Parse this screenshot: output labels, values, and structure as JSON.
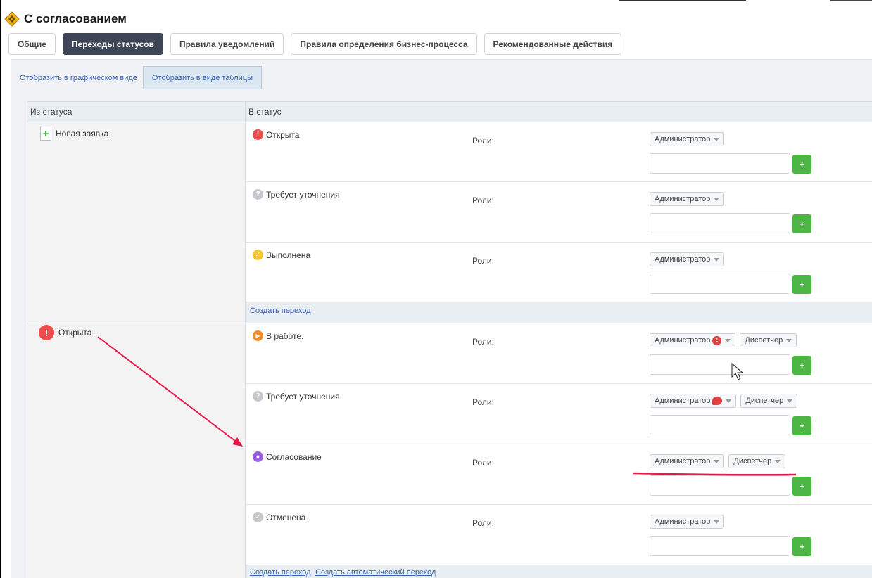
{
  "title": "С согласованием",
  "tabs": [
    {
      "label": "Общие",
      "active": false
    },
    {
      "label": "Переходы статусов",
      "active": true
    },
    {
      "label": "Правила уведомлений",
      "active": false
    },
    {
      "label": "Правила определения бизнес-процесса",
      "active": false
    },
    {
      "label": "Рекомендованные действия",
      "active": false
    }
  ],
  "view": {
    "graphic": "Отобразить в графическом виде",
    "table": "Отобразить в виде таблицы"
  },
  "table": {
    "col_from": "Из статуса",
    "col_to": "В статус",
    "roles_label": "Роли:",
    "add_symbol": "+"
  },
  "groups": [
    {
      "from": "Новая заявка",
      "from_icon": "plus-icon",
      "transitions": [
        {
          "status": "Открыта",
          "icon": "exclamation-icon",
          "roles": [
            "Администратор"
          ]
        },
        {
          "status": "Требует уточнения",
          "icon": "question-icon",
          "roles": [
            "Администратор"
          ]
        },
        {
          "status": "Выполнена",
          "icon": "check-icon",
          "roles": [
            "Администратор"
          ]
        }
      ],
      "links": [
        "Создать переход"
      ]
    },
    {
      "from": "Открыта",
      "from_icon": "exclamation-icon",
      "transitions": [
        {
          "status": "В работе.",
          "icon": "play-icon",
          "roles": [
            "Администратор",
            "Диспетчер"
          ]
        },
        {
          "status": "Требует уточнения",
          "icon": "question-icon",
          "roles": [
            "Администратор",
            "Диспетчер"
          ]
        },
        {
          "status": "Согласование",
          "icon": "drop-icon",
          "roles": [
            "Администратор",
            "Диспетчер"
          ]
        },
        {
          "status": "Отменена",
          "icon": "cancel-check-icon",
          "roles": [
            "Администратор"
          ]
        }
      ],
      "links": [
        "Создать переход",
        "Создать автоматический переход"
      ]
    }
  ],
  "colors": {
    "active_tab": "#3d4557",
    "link": "#3a62b0",
    "add_button": "#4cb543",
    "annotation": "#e8174a",
    "status_open": "#ef4d4d",
    "status_in_work": "#f08a24",
    "status_done": "#f2c531",
    "status_approval": "#9b5de5",
    "status_neutral": "#c4c7cc"
  }
}
